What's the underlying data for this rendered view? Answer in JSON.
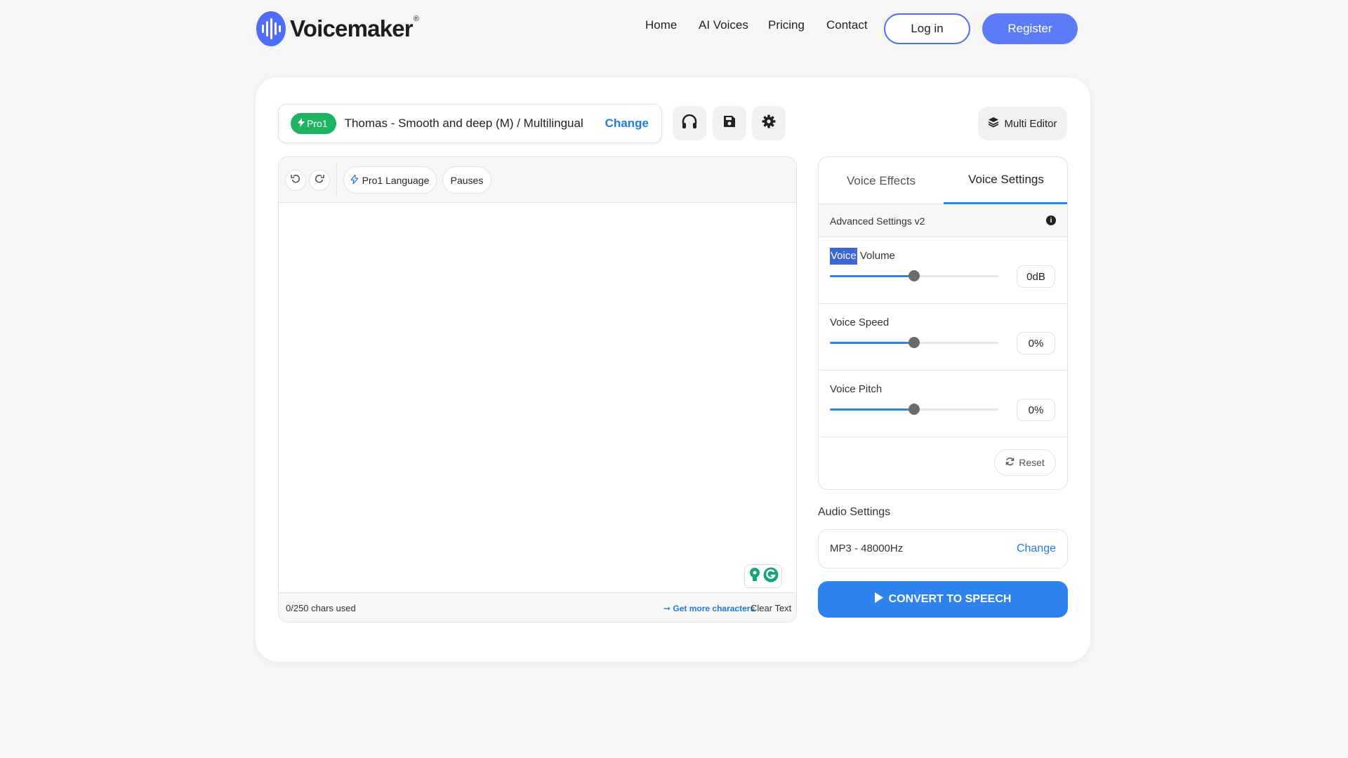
{
  "brand": {
    "name": "Voicemaker",
    "registered_mark": "®",
    "color": "#4f6ef7"
  },
  "nav": {
    "items": [
      {
        "label": "Home"
      },
      {
        "label": "AI Voices"
      },
      {
        "label": "Pricing"
      },
      {
        "label": "Contact"
      }
    ],
    "login_label": "Log in",
    "register_label": "Register"
  },
  "voice": {
    "badge": "Pro1",
    "name": "Thomas - Smooth and deep (M) / Multilingual",
    "change_label": "Change"
  },
  "toolbar_icons": [
    "headphones-icon",
    "save-icon",
    "gear-icon"
  ],
  "multi_editor_label": "Multi Editor",
  "editor": {
    "chips": [
      {
        "label": "Pro1 Language"
      },
      {
        "label": "Pauses"
      }
    ],
    "text": "",
    "chars_used": "0/250 chars used",
    "more_chars_label": "➞ Get more characters",
    "clear_label": "Clear Text"
  },
  "panel": {
    "tabs": [
      {
        "label": "Voice Effects",
        "active": false
      },
      {
        "label": "Voice Settings",
        "active": true
      }
    ],
    "advanced_label": "Advanced Settings v2",
    "sliders": [
      {
        "label_highlight": "Voice",
        "label_rest": " Volume",
        "value": "0dB",
        "level": 0.5
      },
      {
        "label_highlight": "",
        "label_rest": "Voice Speed",
        "value": "0%",
        "level": 0.5
      },
      {
        "label_highlight": "",
        "label_rest": "Voice Pitch",
        "value": "0%",
        "level": 0.5
      }
    ],
    "reset_label": "Reset"
  },
  "audio": {
    "title": "Audio Settings",
    "format": "MP3 - 48000Hz",
    "change_label": "Change"
  },
  "convert_label": "CONVERT TO SPEECH",
  "colors": {
    "accent_blue": "#2d82ee",
    "pro_green": "#1fb463",
    "register_blue": "#5b7cf6"
  }
}
